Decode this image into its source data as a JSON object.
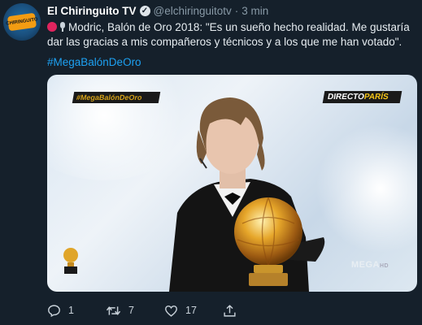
{
  "tweet": {
    "avatar_text": "CHIRINGUITO",
    "name": "El Chiringuito TV",
    "handle": "@elchiringuitotv",
    "separator": "·",
    "time": "3 min",
    "text": "Modric, Balón de Oro 2018: \"Es un sueño hecho realidad. Me gustaría dar las gracias a mis compañeros y técnicos y a los que me han votado\".",
    "hashtag": "#MegaBalónDeOro"
  },
  "media": {
    "tag_left": "#MegaBalónDeOro",
    "tag_right_main": "DIRECTO",
    "tag_right_accent": "PARÍS",
    "channel_logo": "MEGA",
    "channel_logo_suffix": "HD"
  },
  "actions": {
    "reply_count": "1",
    "retweet_count": "7",
    "like_count": "17"
  },
  "icons": {
    "verified": "verified-badge-icon",
    "reply": "reply-icon",
    "retweet": "retweet-icon",
    "like": "like-icon",
    "share": "share-icon"
  },
  "colors": {
    "background": "#15202b",
    "link": "#1da1f2",
    "muted": "#8899a6",
    "gold": "#d4a017"
  }
}
